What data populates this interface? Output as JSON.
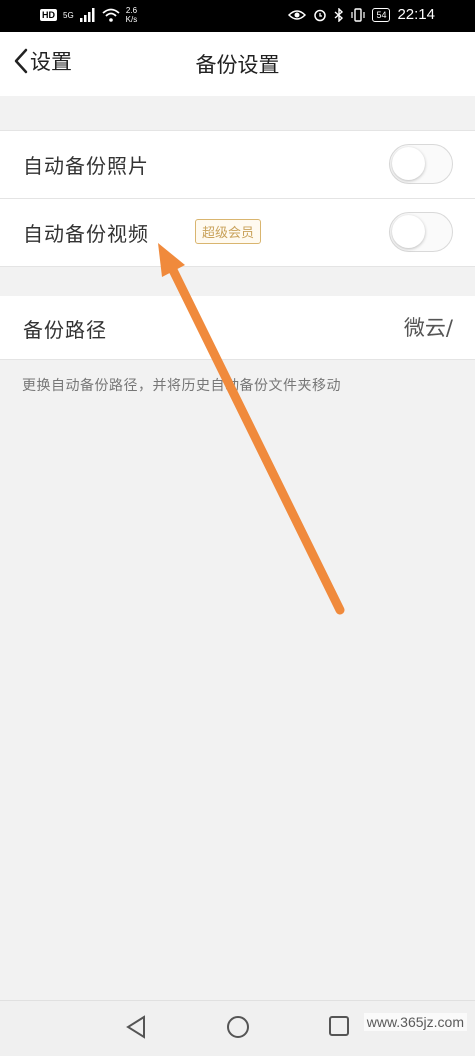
{
  "status_bar": {
    "hd": "HD",
    "network": "5G",
    "speed": "2.6",
    "speed_unit": "K/s",
    "battery": "54",
    "time": "22:14"
  },
  "header": {
    "back_label": "设置",
    "title": "备份设置"
  },
  "settings": {
    "auto_backup_photos": {
      "label": "自动备份照片",
      "enabled": false
    },
    "auto_backup_videos": {
      "label": "自动备份视频",
      "badge": "超级会员",
      "enabled": false
    },
    "backup_path": {
      "label": "备份路径",
      "value": "微云/"
    },
    "hint": "更换自动备份路径，并将历史自动备份文件夹移动"
  },
  "annotation": {
    "color": "#f08a3c"
  },
  "watermark": "www.365jz.com",
  "colors": {
    "background": "#f2f2f2",
    "badge": "#c9a25b",
    "arrow": "#f08a3c"
  }
}
